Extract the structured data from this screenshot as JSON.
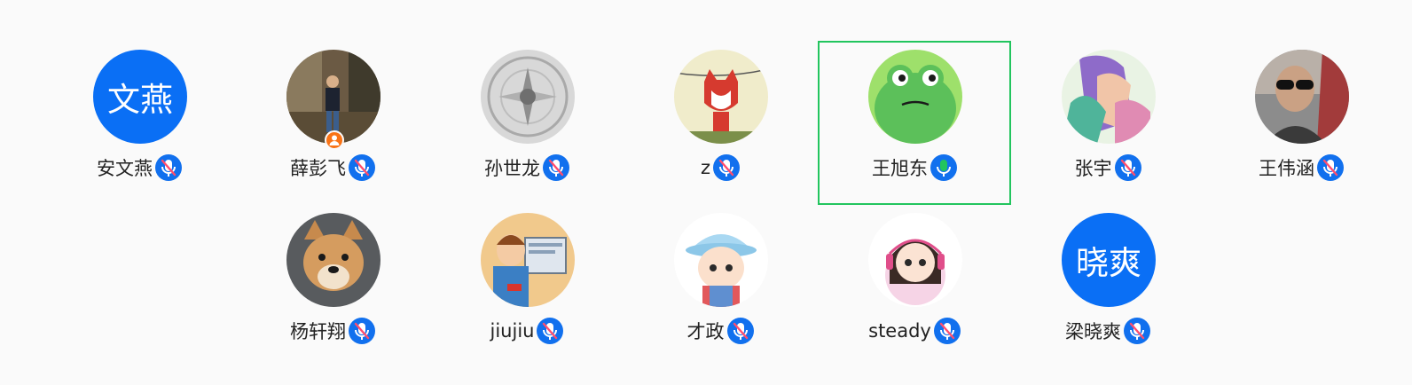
{
  "colors": {
    "accent": "#0a6ff5",
    "speaking_border": "#22c55e",
    "mic_on": "#22c55e",
    "host_badge": "#f97316"
  },
  "participants": [
    {
      "name": "安文燕",
      "avatar_text": "文燕",
      "mic": "muted",
      "speaking": false,
      "host": false
    },
    {
      "name": "薛彭飞",
      "mic": "muted",
      "speaking": false,
      "host": true
    },
    {
      "name": "孙世龙",
      "mic": "muted",
      "speaking": false,
      "host": false
    },
    {
      "name": "z",
      "mic": "muted",
      "speaking": false,
      "host": false
    },
    {
      "name": "王旭东",
      "mic": "active",
      "speaking": true,
      "host": false
    },
    {
      "name": "张宇",
      "mic": "muted",
      "speaking": false,
      "host": false
    },
    {
      "name": "王伟涵",
      "mic": "muted",
      "speaking": false,
      "host": false
    },
    {
      "name": "杨轩翔",
      "mic": "muted",
      "speaking": false,
      "host": false
    },
    {
      "name": "jiujiu",
      "mic": "muted",
      "speaking": false,
      "host": false
    },
    {
      "name": "才政",
      "mic": "muted",
      "speaking": false,
      "host": false
    },
    {
      "name": "steady",
      "mic": "muted",
      "speaking": false,
      "host": false
    },
    {
      "name": "梁晓爽",
      "avatar_text": "晓爽",
      "mic": "muted",
      "speaking": false,
      "host": false
    }
  ]
}
